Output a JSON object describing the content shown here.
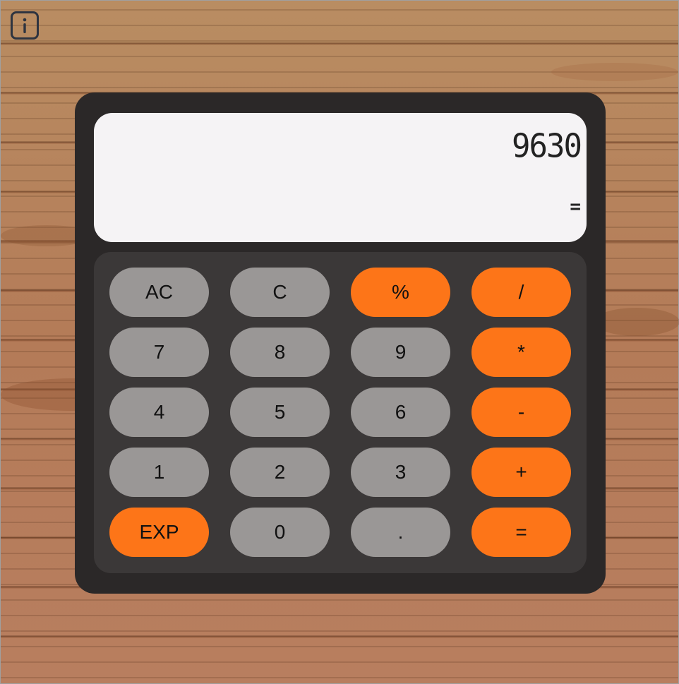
{
  "info": {
    "icon": "info-icon"
  },
  "display": {
    "value": "9630",
    "operator": "="
  },
  "keys": {
    "ac": "AC",
    "c": "C",
    "percent": "%",
    "divide": "/",
    "seven": "7",
    "eight": "8",
    "nine": "9",
    "multiply": "*",
    "four": "4",
    "five": "5",
    "six": "6",
    "subtract": "-",
    "one": "1",
    "two": "2",
    "three": "3",
    "add": "+",
    "exp": "EXP",
    "zero": "0",
    "decimal": ".",
    "equals": "="
  },
  "colors": {
    "gray_key": "#9a9796",
    "orange_key": "#fd7518",
    "body": "#2b2828",
    "keypad": "#3b3838",
    "display": "#f5f3f5"
  }
}
